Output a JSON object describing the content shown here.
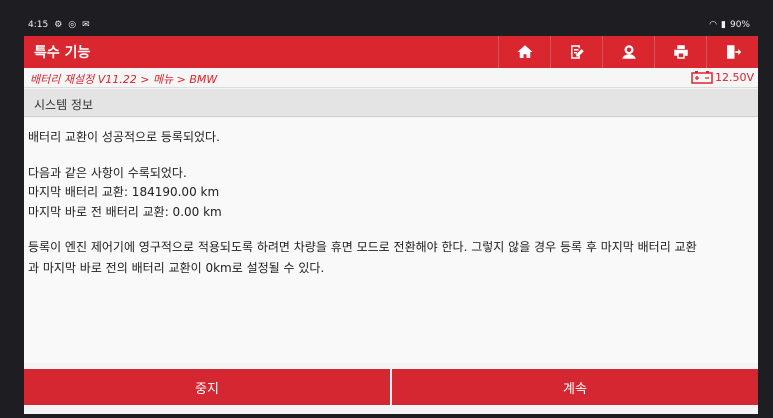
{
  "statusbar": {
    "time": "4:15",
    "battery": "90%"
  },
  "header": {
    "title": "특수 기능",
    "buttons": [
      {
        "icon": "home-icon"
      },
      {
        "icon": "edit-report-icon"
      },
      {
        "icon": "user-icon"
      },
      {
        "icon": "print-icon"
      },
      {
        "icon": "exit-icon"
      }
    ]
  },
  "breadcrumb": "배터리 재설정 V11.22 > 메뉴 > BMW",
  "voltage": "12.50V",
  "section_title": "시스템 정보",
  "content": {
    "line1": "배터리 교환이 성공적으로 등록되었다.",
    "line2": "다음과 같은 사항이 수록되었다.",
    "line3": "마지막 배터리 교환:  184190.00   km",
    "line4": "마지막 바로 전 배터리 교환:  0.00   km",
    "line5": "등록이 엔진 제어기에 영구적으로 적용되도록 하려면 차량을 휴면 모드로 전환해야 한다. 그렇지 않을 경우 등록 후 마지막 배터리 교환",
    "line6": "과 마지막 바로 전의 배터리 교환이 0km로 설정될 수 있다."
  },
  "footer": {
    "stop": "중지",
    "continue": "계속"
  },
  "colors": {
    "accent": "#d9262f"
  }
}
